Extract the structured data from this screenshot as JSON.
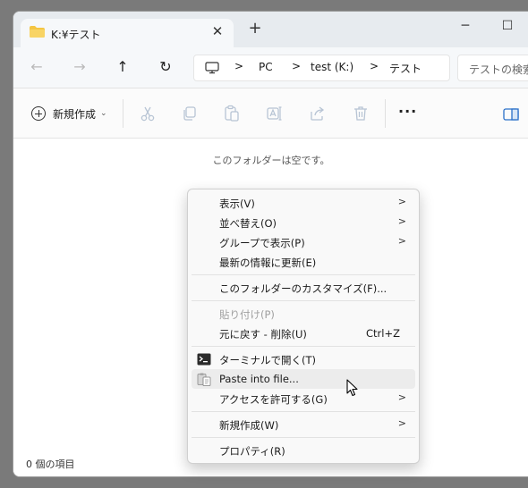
{
  "tab": {
    "title": "K:¥テスト",
    "close": "✕",
    "new_tab": "+"
  },
  "window_controls": {
    "minimize": "─",
    "maximize": "☐"
  },
  "nav": {
    "back": "←",
    "forward": "→",
    "up": "↑",
    "refresh": "↻"
  },
  "breadcrumb": {
    "sep": ">",
    "items": [
      "PC",
      "test (K:)",
      "テスト"
    ]
  },
  "search": {
    "placeholder": "テストの検索"
  },
  "commandbar": {
    "new_label": "新規作成",
    "new_chevron": "⌄",
    "more": "···"
  },
  "content": {
    "empty_message": "このフォルダーは空です。",
    "status": "0 個の項目"
  },
  "context_menu": {
    "items": [
      {
        "label": "表示(V)",
        "arrow": ">"
      },
      {
        "label": "並べ替え(O)",
        "arrow": ">"
      },
      {
        "label": "グループで表示(P)",
        "arrow": ">"
      },
      {
        "label": "最新の情報に更新(E)"
      },
      {
        "label": "このフォルダーのカスタマイズ(F)..."
      },
      {
        "label": "貼り付け(P)",
        "disabled": true
      },
      {
        "label": "元に戻す - 削除(U)",
        "shortcut": "Ctrl+Z"
      },
      {
        "label": "ターミナルで開く(T)",
        "icon": "terminal-icon"
      },
      {
        "label": "Paste into file...",
        "icon": "paste-file-icon"
      },
      {
        "label": "アクセスを許可する(G)",
        "arrow": ">"
      },
      {
        "label": "新規作成(W)",
        "arrow": ">"
      },
      {
        "label": "プロパティ(R)"
      }
    ]
  },
  "colors": {
    "accent": "#f4c542",
    "hover": "#ececec",
    "disabled": "#a0a0a0"
  }
}
